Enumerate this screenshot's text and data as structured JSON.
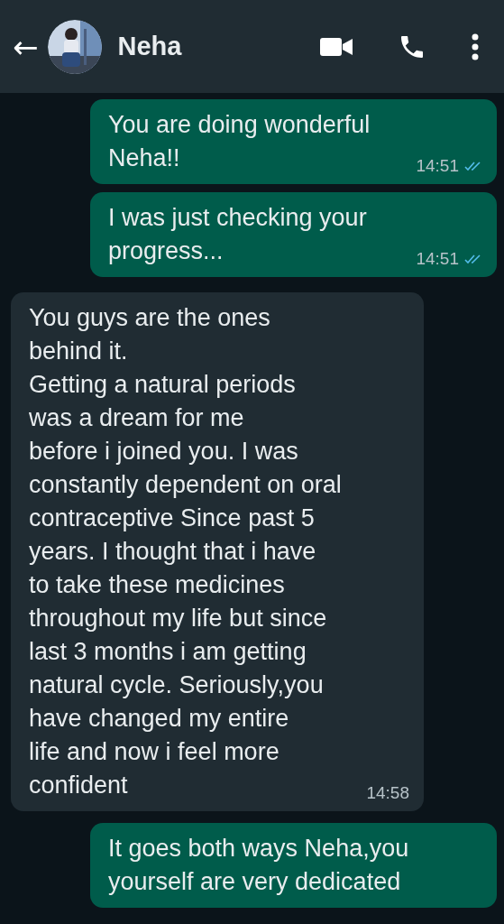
{
  "header": {
    "back": "←",
    "contact_name": "Neha"
  },
  "messages": [
    {
      "kind": "out",
      "text": "You are doing wonderful\nNeha!!",
      "time": "14:51",
      "read": true
    },
    {
      "kind": "out",
      "text": "I was just checking your\nprogress...",
      "time": "14:51",
      "read": true
    },
    {
      "kind": "in",
      "text": "You guys are the ones\nbehind it.\nGetting a natural periods\nwas a dream for me\nbefore i joined you. I was\nconstantly dependent on oral\ncontraceptive Since past 5\nyears. I thought that i have\nto take these medicines\nthroughout my life but since\nlast 3 months i am getting\nnatural cycle. Seriously,you\nhave changed my entire\nlife and now i feel more\nconfident",
      "time": "14:58"
    },
    {
      "kind": "out",
      "text": "It goes both ways Neha,you\nyourself are very dedicated"
    }
  ]
}
